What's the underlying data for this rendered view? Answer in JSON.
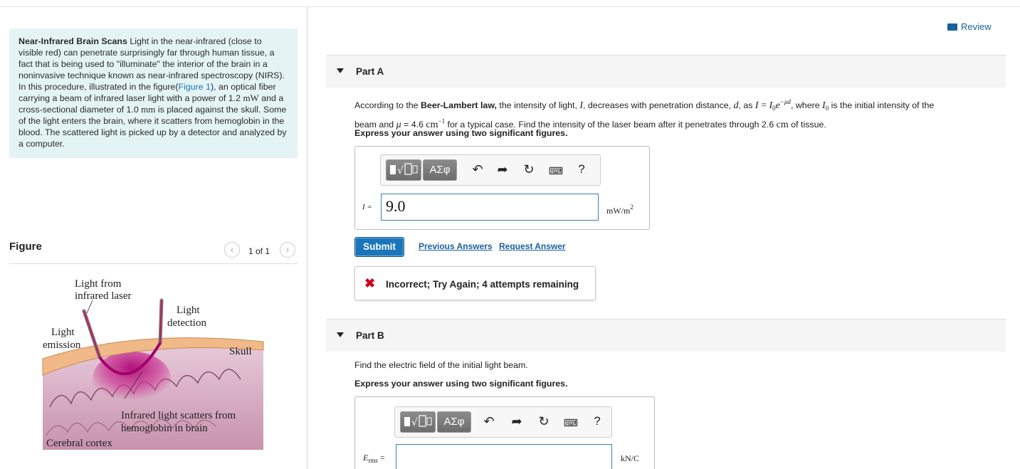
{
  "intro": {
    "title": "Near-Infrared Brain Scans",
    "text1": " Light in the near-infrared (close to visible red) can penetrate surprisingly far through human tissue, a fact that is being used to \"illuminate\" the interior of the brain in a noninvasive technique known as near-infrared spectroscopy (NIRS). In this procedure, illustrated in the figure(",
    "figure_link": "Figure 1",
    "text2": "), an optical fiber carrying a beam of infrared laser light with a power of 1.2 ",
    "power_unit": "mW",
    "text3": " and a cross-sectional diameter of 1.0 ",
    "diam_unit": "mm",
    "text4": " is placed against the skull. Some of the light enters the brain, where it scatters from hemoglobin in the blood. The scattered light is picked up by a detector and analyzed by a computer."
  },
  "figure": {
    "title": "Figure",
    "pager": "1 of 1",
    "prev_icon": "chevron-left-icon",
    "next_icon": "chevron-right-icon",
    "labels": {
      "laser1": "Light from",
      "laser2": "infrared laser",
      "detect1": "Light",
      "detect2": "detection",
      "emit1": "Light",
      "emit2": "emission",
      "skull": "Skull",
      "scatter1": "Infrared light scatters from",
      "scatter2": "hemoglobin in brain",
      "cortex": "Cerebral cortex"
    }
  },
  "review": "Review",
  "partA": {
    "label": "Part A",
    "q1": "According to the ",
    "q_bold": "Beer-Lambert law,",
    "q2": " the intensity of light, ",
    "q3": ", decreases with penetration distance, ",
    "q4": ", as ",
    "q5": ", where ",
    "q6": " is the initial intensity of the",
    "q7": "beam and ",
    "q8": " = 4.6 ",
    "q8_unit": "cm",
    "q8_exp": "−1",
    "q9": " for a typical case. Find the intensity of the laser beam after it penetrates through 2.6 ",
    "q9_unit": "cm",
    "q10": " of tissue.",
    "instruction": "Express your answer using two significant figures.",
    "answer_label": "I =",
    "answer_value": "9.0",
    "unit": "mW/m",
    "unit_exp": "2",
    "submit": "Submit",
    "prev_answers": "Previous Answers",
    "request_answer": "Request Answer",
    "feedback": "Incorrect; Try Again; 4 attempts remaining"
  },
  "partB": {
    "label": "Part B",
    "question": "Find the electric field of the initial light beam.",
    "instruction": "Express your answer using two significant figures.",
    "answer_label": "E",
    "answer_sub": "rms",
    "answer_eq": " =",
    "answer_value": "",
    "unit": "kN/C"
  },
  "toolbar": {
    "template_icon": "template-icon",
    "greek": "ΑΣφ",
    "undo_icon": "undo-icon",
    "redo_icon": "redo-icon",
    "reset_icon": "reset-icon",
    "keyboard_icon": "keyboard-icon",
    "help": "?"
  },
  "colors": {
    "link": "#1a5f9e",
    "submit_bg": "#1a75bb",
    "intro_bg": "#e4f4f4",
    "error": "#d0021b"
  }
}
